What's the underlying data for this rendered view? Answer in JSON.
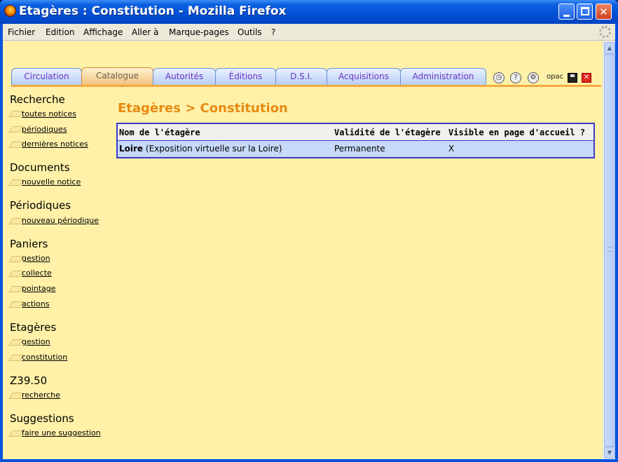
{
  "window": {
    "title": "Etagères : Constitution - Mozilla Firefox",
    "min_symbol": "",
    "close_symbol": "✕"
  },
  "menubar": {
    "items": [
      "Fichier",
      "Edition",
      "Affichage",
      "Aller à",
      "Marque-pages",
      "Outils",
      "?"
    ]
  },
  "tabs": [
    {
      "label": "Circulation",
      "active": false
    },
    {
      "label": "Catalogue",
      "active": true
    },
    {
      "label": "Autorités",
      "active": false
    },
    {
      "label": "Éditions",
      "active": false
    },
    {
      "label": "D.S.I.",
      "active": false
    },
    {
      "label": "Acquisitions",
      "active": false
    },
    {
      "label": "Administration",
      "active": false
    }
  ],
  "toolbar_icons": {
    "opac_label": "opac"
  },
  "sidebar": {
    "sections": [
      {
        "title": "Recherche",
        "links": [
          "toutes notices",
          "périodiques",
          "dernières notices"
        ]
      },
      {
        "title": "Documents",
        "links": [
          "nouvelle notice"
        ]
      },
      {
        "title": "Périodiques",
        "links": [
          "nouveau périodique"
        ]
      },
      {
        "title": "Paniers",
        "links": [
          "gestion",
          "collecte",
          "pointage",
          "actions"
        ]
      },
      {
        "title": "Etagères",
        "links": [
          "gestion",
          "constitution"
        ]
      },
      {
        "title": "Z39.50",
        "links": [
          "recherche"
        ]
      },
      {
        "title": "Suggestions",
        "links": [
          "faire une suggestion"
        ]
      }
    ]
  },
  "main": {
    "title": "Etagères > Constitution",
    "table": {
      "headers": [
        "Nom de l'étagère",
        "Validité de l'étagère",
        "Visible en page d'accueil ?"
      ],
      "rows": [
        {
          "name": "Loire",
          "description": "(Exposition virtuelle sur la Loire)",
          "validity": "Permanente",
          "visible": "X"
        }
      ]
    }
  },
  "colors": {
    "title_orange": "#e88a12",
    "page_background": "#fff1a8",
    "table_border": "#3b3bc8",
    "row_highlight": "#c7d9f9"
  }
}
